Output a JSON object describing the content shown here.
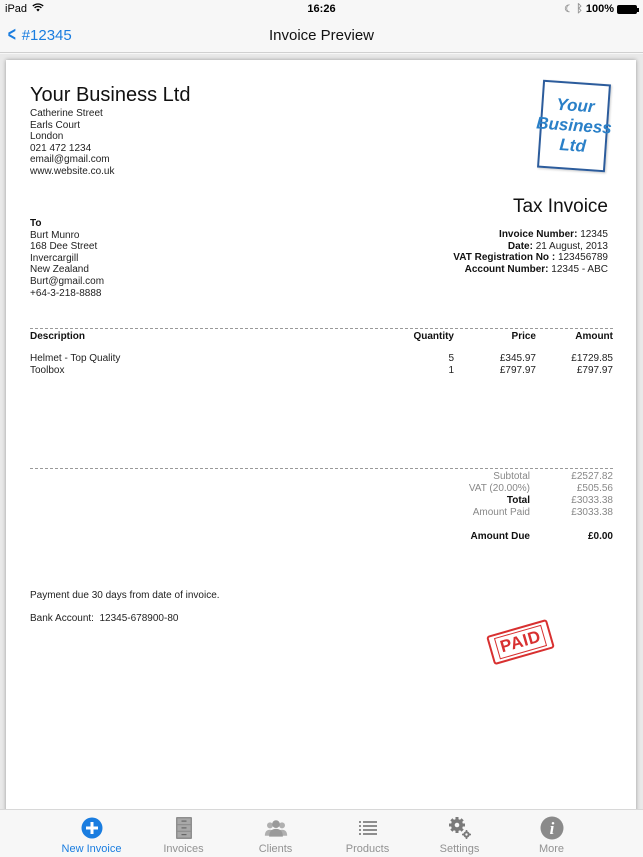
{
  "status_bar": {
    "device": "iPad",
    "time": "16:26",
    "battery": "100%"
  },
  "nav": {
    "back_label": "#12345",
    "title": "Invoice Preview"
  },
  "business": {
    "name": "Your Business Ltd",
    "lines": [
      "Catherine Street",
      "Earls Court",
      "London",
      "021 472 1234",
      "email@gmail.com",
      "www.website.co.uk"
    ],
    "logo_lines": [
      "Your",
      "Business",
      "Ltd"
    ]
  },
  "invoice": {
    "title": "Tax Invoice",
    "meta": [
      {
        "label": "Invoice Number:",
        "value": "12345"
      },
      {
        "label": "Date:",
        "value": "21 August, 2013"
      },
      {
        "label": "VAT Registration No :",
        "value": "123456789"
      },
      {
        "label": "Account Number:",
        "value": "12345 - ABC"
      }
    ]
  },
  "recipient": {
    "label": "To",
    "lines": [
      "Burt Munro",
      "168 Dee Street",
      "Invercargill",
      "New Zealand",
      "Burt@gmail.com",
      "+64-3-218-8888"
    ]
  },
  "table": {
    "headers": {
      "description": "Description",
      "quantity": "Quantity",
      "price": "Price",
      "amount": "Amount"
    },
    "rows": [
      {
        "description": "Helmet - Top Quality",
        "quantity": "5",
        "price": "£345.97",
        "amount": "£1729.85"
      },
      {
        "description": "Toolbox",
        "quantity": "1",
        "price": "£797.97",
        "amount": "£797.97"
      }
    ]
  },
  "totals": {
    "subtotal_label": "Subtotal",
    "subtotal": "£2527.82",
    "vat_label": "VAT (20.00%)",
    "vat": "£505.56",
    "total_label": "Total",
    "total": "£3033.38",
    "paid_label": "Amount Paid",
    "paid": "£3033.38",
    "due_label": "Amount Due",
    "due": "£0.00"
  },
  "notes": {
    "payment_terms": "Payment due 30 days from date of invoice.",
    "bank_account": "Bank Account:  12345-678900-80"
  },
  "stamp": "PAID",
  "tabs": [
    {
      "label": "New Invoice",
      "icon": "plus-circle-icon",
      "active": true
    },
    {
      "label": "Invoices",
      "icon": "cabinet-icon",
      "active": false
    },
    {
      "label": "Clients",
      "icon": "people-icon",
      "active": false
    },
    {
      "label": "Products",
      "icon": "list-icon",
      "active": false
    },
    {
      "label": "Settings",
      "icon": "gears-icon",
      "active": false
    },
    {
      "label": "More",
      "icon": "info-icon",
      "active": false
    }
  ],
  "colors": {
    "accent": "#1a7de0",
    "stamp": "#d83030",
    "logo": "#2a80c8"
  }
}
